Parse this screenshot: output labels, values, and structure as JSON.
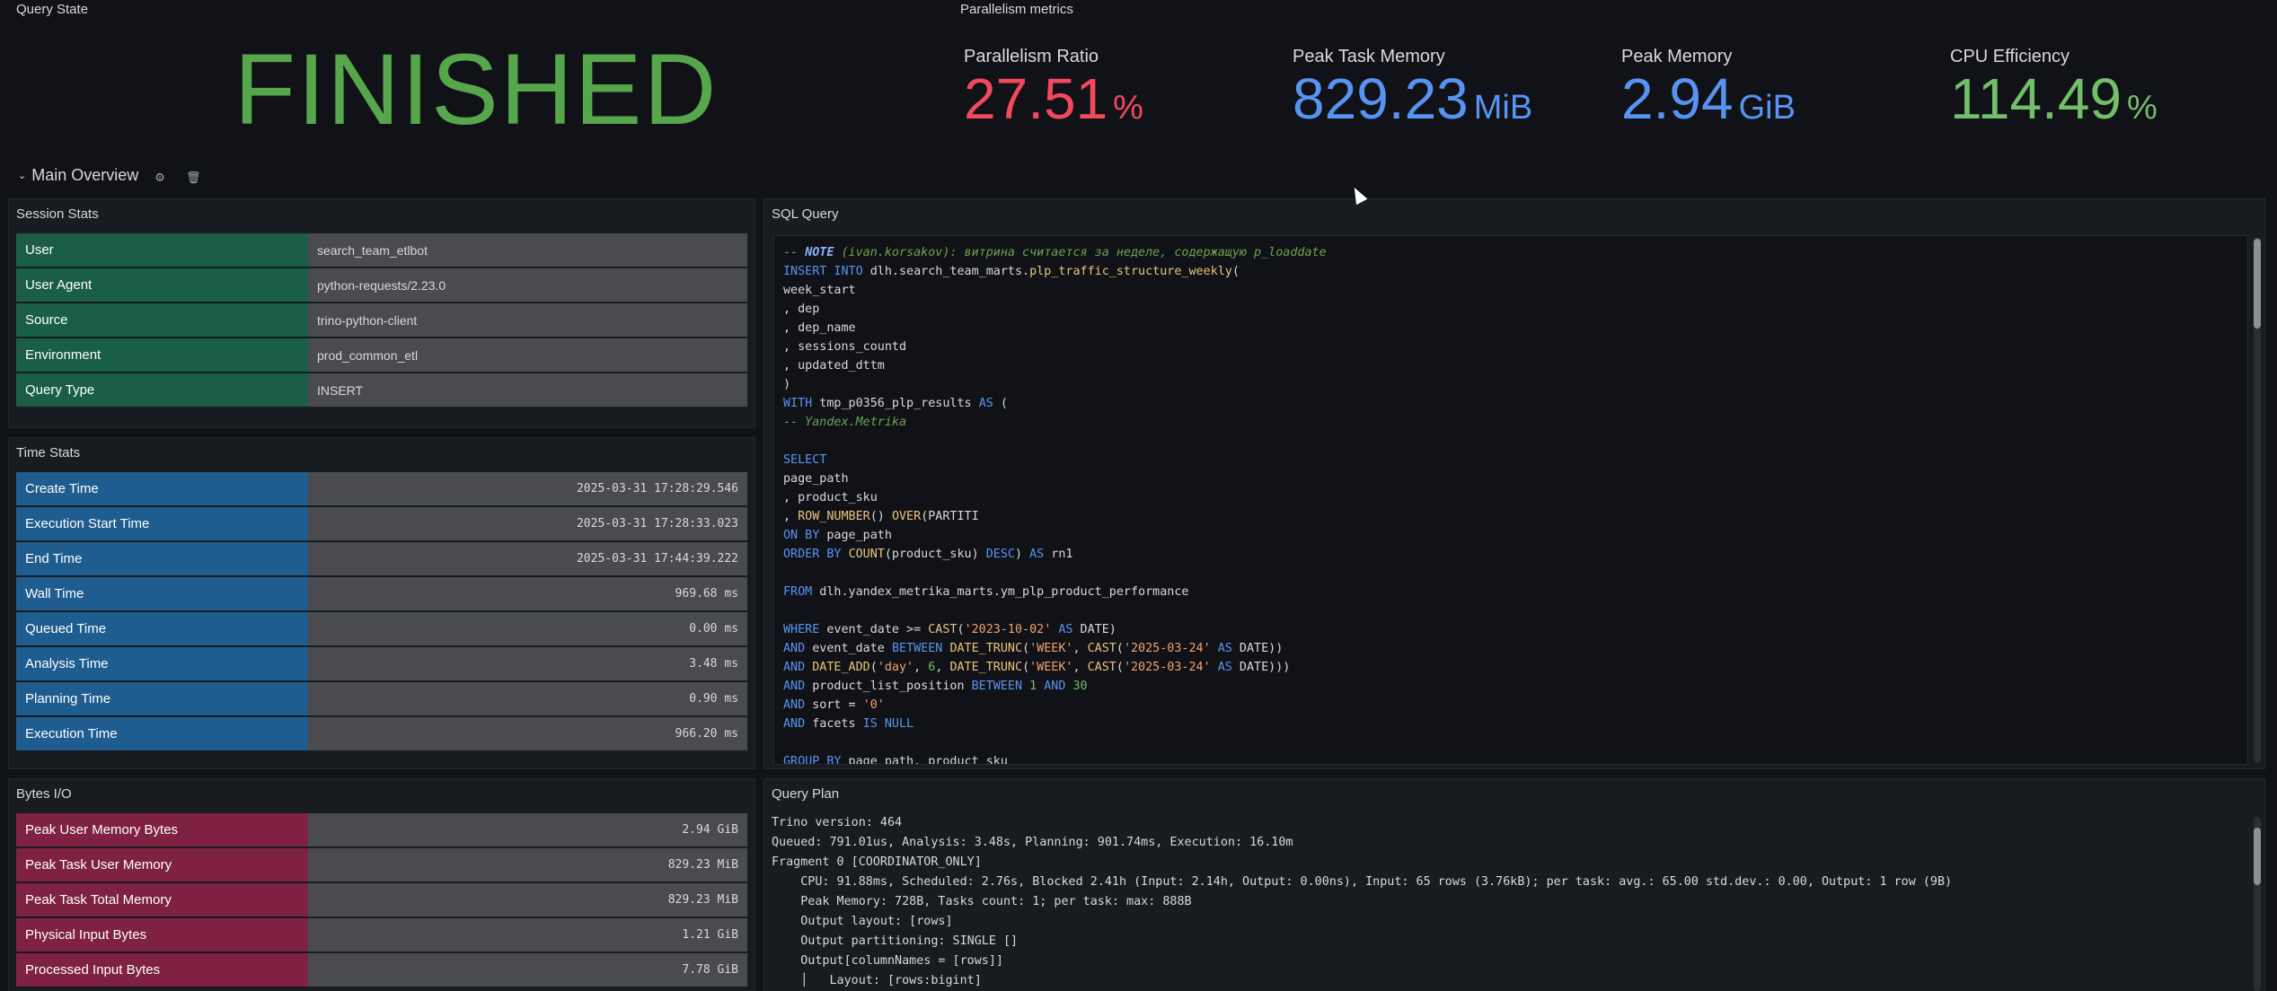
{
  "query_state": {
    "title": "Query State",
    "value": "FINISHED",
    "color": "#56a64b"
  },
  "parallelism": {
    "title": "Parallelism metrics",
    "stats": [
      {
        "label": "Parallelism Ratio",
        "value": "27.51",
        "unit": "%",
        "color": "#f2495c"
      },
      {
        "label": "Peak Task Memory",
        "value": "829.23",
        "unit": "MiB",
        "color": "#5794f2"
      },
      {
        "label": "Peak Memory",
        "value": "2.94",
        "unit": "GiB",
        "color": "#5794f2"
      },
      {
        "label": "CPU Efficiency",
        "value": "114.49",
        "unit": "%",
        "color": "#73bf69"
      }
    ]
  },
  "main_overview": {
    "title": "Main Overview",
    "collapse_icon": "chevron-down-icon",
    "settings_icon": "gear-icon",
    "delete_icon": "trash-icon"
  },
  "session_stats": {
    "title": "Session Stats",
    "rows": [
      {
        "key": "User",
        "value": "search_team_etlbot"
      },
      {
        "key": "User Agent",
        "value": "python-requests/2.23.0"
      },
      {
        "key": "Source",
        "value": "trino-python-client"
      },
      {
        "key": "Environment",
        "value": "prod_common_etl"
      },
      {
        "key": "Query Type",
        "value": "INSERT"
      }
    ]
  },
  "time_stats": {
    "title": "Time Stats",
    "rows": [
      {
        "key": "Create Time",
        "value": "2025-03-31 17:28:29.546"
      },
      {
        "key": "Execution Start Time",
        "value": "2025-03-31 17:28:33.023"
      },
      {
        "key": "End Time",
        "value": "2025-03-31 17:44:39.222"
      },
      {
        "key": "Wall Time",
        "value": "969.68 ms"
      },
      {
        "key": "Queued Time",
        "value": "0.00 ms"
      },
      {
        "key": "Analysis Time",
        "value": "3.48 ms"
      },
      {
        "key": "Planning Time",
        "value": "0.90 ms"
      },
      {
        "key": "Execution Time",
        "value": "966.20 ms"
      }
    ]
  },
  "bytes_io": {
    "title": "Bytes I/O",
    "rows": [
      {
        "key": "Peak User Memory Bytes",
        "value": "2.94 GiB"
      },
      {
        "key": "Peak Task User Memory",
        "value": "829.23 MiB"
      },
      {
        "key": "Peak Task Total Memory",
        "value": "829.23 MiB"
      },
      {
        "key": "Physical Input Bytes",
        "value": "1.21 GiB"
      },
      {
        "key": "Processed Input Bytes",
        "value": "7.78 GiB"
      }
    ]
  },
  "sql_query": {
    "title": "SQL Query",
    "lines": [
      {
        "t": [
          {
            "c": "cm",
            "s": "-- "
          },
          {
            "c": "cm b",
            "s": "NOTE"
          },
          {
            "c": "cm",
            "s": " (ivan.korsakov): витрина считается за неделе, содержащую p_loaddate"
          }
        ]
      },
      {
        "t": [
          {
            "c": "kw",
            "s": "INSERT INTO"
          },
          {
            "c": "",
            "s": " dlh.search_team_marts."
          },
          {
            "c": "fn",
            "s": "plp_traffic_structure_weekly"
          },
          {
            "c": "",
            "s": "("
          }
        ]
      },
      {
        "t": [
          {
            "c": "",
            "s": "week_start"
          }
        ]
      },
      {
        "t": [
          {
            "c": "",
            "s": ", dep"
          }
        ]
      },
      {
        "t": [
          {
            "c": "",
            "s": ", dep_name"
          }
        ]
      },
      {
        "t": [
          {
            "c": "",
            "s": ", sessions_countd"
          }
        ]
      },
      {
        "t": [
          {
            "c": "",
            "s": ", updated_dttm"
          }
        ]
      },
      {
        "t": [
          {
            "c": "",
            "s": ")"
          }
        ]
      },
      {
        "t": [
          {
            "c": "kw",
            "s": "WITH"
          },
          {
            "c": "",
            "s": " tmp_p0356_plp_results "
          },
          {
            "c": "kw",
            "s": "AS"
          },
          {
            "c": "",
            "s": " ("
          }
        ]
      },
      {
        "t": [
          {
            "c": "cm",
            "s": "-- Yandex.Metrika"
          }
        ]
      },
      {
        "t": [
          {
            "c": "",
            "s": ""
          }
        ]
      },
      {
        "t": [
          {
            "c": "kw",
            "s": "SELECT"
          }
        ]
      },
      {
        "t": [
          {
            "c": "",
            "s": "page_path"
          }
        ]
      },
      {
        "t": [
          {
            "c": "",
            "s": ", product_sku"
          }
        ]
      },
      {
        "t": [
          {
            "c": "",
            "s": ", "
          },
          {
            "c": "fn",
            "s": "ROW_NUMBER"
          },
          {
            "c": "",
            "s": "() "
          },
          {
            "c": "fn",
            "s": "OVER"
          },
          {
            "c": "",
            "s": "(PARTITI"
          }
        ]
      },
      {
        "t": [
          {
            "c": "kw",
            "s": "ON BY"
          },
          {
            "c": "",
            "s": " page_path"
          }
        ]
      },
      {
        "t": [
          {
            "c": "kw",
            "s": "ORDER BY"
          },
          {
            "c": "",
            "s": " "
          },
          {
            "c": "fn",
            "s": "COUNT"
          },
          {
            "c": "",
            "s": "(product_sku) "
          },
          {
            "c": "kw",
            "s": "DESC"
          },
          {
            "c": "",
            "s": ") "
          },
          {
            "c": "kw",
            "s": "AS"
          },
          {
            "c": "",
            "s": " rn1"
          }
        ]
      },
      {
        "t": [
          {
            "c": "",
            "s": ""
          }
        ]
      },
      {
        "t": [
          {
            "c": "kw",
            "s": "FROM"
          },
          {
            "c": "",
            "s": " dlh.yandex_metrika_marts.ym_plp_product_performance"
          }
        ]
      },
      {
        "t": [
          {
            "c": "",
            "s": ""
          }
        ]
      },
      {
        "t": [
          {
            "c": "kw",
            "s": "WHERE"
          },
          {
            "c": "",
            "s": " event_date >= "
          },
          {
            "c": "fn",
            "s": "CAST"
          },
          {
            "c": "",
            "s": "("
          },
          {
            "c": "str",
            "s": "'2023-10-02'"
          },
          {
            "c": "",
            "s": " "
          },
          {
            "c": "kw",
            "s": "AS"
          },
          {
            "c": "",
            "s": " DATE)"
          }
        ]
      },
      {
        "t": [
          {
            "c": "kw",
            "s": "AND"
          },
          {
            "c": "",
            "s": " event_date "
          },
          {
            "c": "kw",
            "s": "BETWEEN"
          },
          {
            "c": "",
            "s": " "
          },
          {
            "c": "fn",
            "s": "DATE_TRUNC"
          },
          {
            "c": "",
            "s": "("
          },
          {
            "c": "str",
            "s": "'WEEK'"
          },
          {
            "c": "",
            "s": ", "
          },
          {
            "c": "fn",
            "s": "CAST"
          },
          {
            "c": "",
            "s": "("
          },
          {
            "c": "str",
            "s": "'2025-03-24'"
          },
          {
            "c": "",
            "s": " "
          },
          {
            "c": "kw",
            "s": "AS"
          },
          {
            "c": "",
            "s": " DATE))"
          }
        ]
      },
      {
        "t": [
          {
            "c": "kw",
            "s": "AND"
          },
          {
            "c": "",
            "s": " "
          },
          {
            "c": "fn",
            "s": "DATE_ADD"
          },
          {
            "c": "",
            "s": "("
          },
          {
            "c": "str",
            "s": "'day'"
          },
          {
            "c": "",
            "s": ", "
          },
          {
            "c": "num",
            "s": "6"
          },
          {
            "c": "",
            "s": ", "
          },
          {
            "c": "fn",
            "s": "DATE_TRUNC"
          },
          {
            "c": "",
            "s": "("
          },
          {
            "c": "str",
            "s": "'WEEK'"
          },
          {
            "c": "",
            "s": ", "
          },
          {
            "c": "fn",
            "s": "CAST"
          },
          {
            "c": "",
            "s": "("
          },
          {
            "c": "str",
            "s": "'2025-03-24'"
          },
          {
            "c": "",
            "s": " "
          },
          {
            "c": "kw",
            "s": "AS"
          },
          {
            "c": "",
            "s": " DATE)))"
          }
        ]
      },
      {
        "t": [
          {
            "c": "kw",
            "s": "AND"
          },
          {
            "c": "",
            "s": " product_list_position "
          },
          {
            "c": "kw",
            "s": "BETWEEN"
          },
          {
            "c": "",
            "s": " "
          },
          {
            "c": "num",
            "s": "1"
          },
          {
            "c": "",
            "s": " "
          },
          {
            "c": "kw",
            "s": "AND"
          },
          {
            "c": "",
            "s": " "
          },
          {
            "c": "num",
            "s": "30"
          }
        ]
      },
      {
        "t": [
          {
            "c": "kw",
            "s": "AND"
          },
          {
            "c": "",
            "s": " sort = "
          },
          {
            "c": "str",
            "s": "'0'"
          }
        ]
      },
      {
        "t": [
          {
            "c": "kw",
            "s": "AND"
          },
          {
            "c": "",
            "s": " facets "
          },
          {
            "c": "kw",
            "s": "IS NULL"
          }
        ]
      },
      {
        "t": [
          {
            "c": "",
            "s": ""
          }
        ]
      },
      {
        "t": [
          {
            "c": "kw",
            "s": "GROUP BY"
          },
          {
            "c": "",
            "s": " page_path, product_sku"
          }
        ]
      }
    ]
  },
  "query_plan": {
    "title": "Query Plan",
    "lines": [
      "Trino version: 464",
      "Queued: 791.01us, Analysis: 3.48s, Planning: 901.74ms, Execution: 16.10m",
      "Fragment 0 [COORDINATOR_ONLY]",
      "    CPU: 91.88ms, Scheduled: 2.76s, Blocked 2.41h (Input: 2.14h, Output: 0.00ns), Input: 65 rows (3.76kB); per task: avg.: 65.00 std.dev.: 0.00, Output: 1 row (9B)",
      "    Peak Memory: 728B, Tasks count: 1; per task: max: 888B",
      "    Output layout: [rows]",
      "    Output partitioning: SINGLE []",
      "    Output[columnNames = [rows]]",
      "    │   Layout: [rows:bigint]"
    ]
  }
}
